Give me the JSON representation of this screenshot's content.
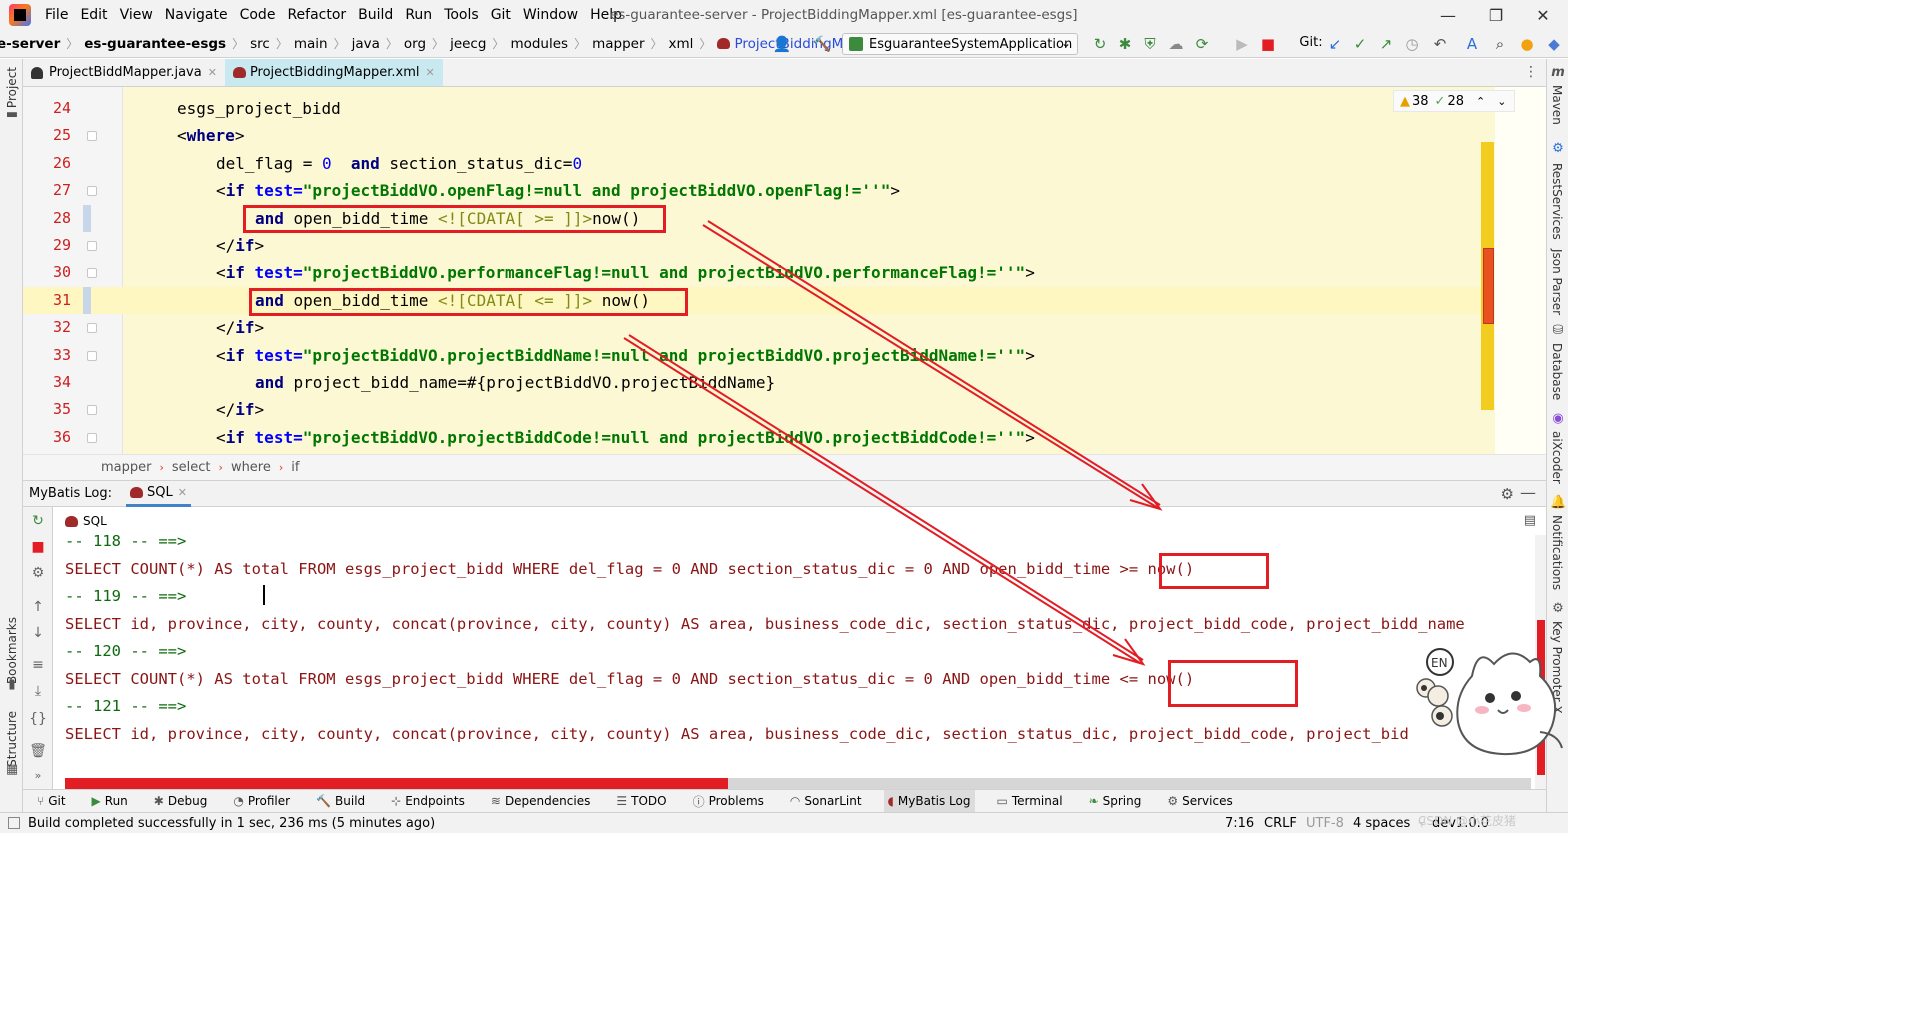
{
  "menubar": {
    "items": [
      "File",
      "Edit",
      "View",
      "Navigate",
      "Code",
      "Refactor",
      "Build",
      "Run",
      "Tools",
      "Git",
      "Window",
      "Help"
    ],
    "window_title": "es-guarantee-server - ProjectBiddingMapper.xml [es-guarantee-esgs]"
  },
  "navbar": {
    "crumbs": [
      "e-server",
      "es-guarantee-esgs",
      "src",
      "main",
      "java",
      "org",
      "jeecg",
      "modules",
      "mapper",
      "xml"
    ],
    "file": "ProjectBiddingMapper.xml",
    "run_config": "EsguaranteeSystemApplication",
    "git_label": "Git:"
  },
  "editor_tabs": [
    {
      "label": "ProjectBiddMapper.java",
      "active": false
    },
    {
      "label": "ProjectBiddingMapper.xml",
      "active": true
    }
  ],
  "inspections": {
    "warnings": "38",
    "weak": "28"
  },
  "code_lines": [
    {
      "num": "24",
      "indent": 0,
      "parts": [
        {
          "t": "esgs_project_bidd",
          "c": ""
        }
      ]
    },
    {
      "num": "25",
      "indent": 0,
      "parts": [
        {
          "t": "<",
          "c": "bracket"
        },
        {
          "t": "where",
          "c": "tag"
        },
        {
          "t": ">",
          "c": "bracket"
        }
      ]
    },
    {
      "num": "26",
      "indent": 1,
      "parts": [
        {
          "t": "del_flag = ",
          "c": ""
        },
        {
          "t": "0",
          "c": "num"
        },
        {
          "t": "  ",
          "c": ""
        },
        {
          "t": "and",
          "c": "kw"
        },
        {
          "t": " section_status_dic=",
          "c": ""
        },
        {
          "t": "0",
          "c": "num"
        }
      ]
    },
    {
      "num": "27",
      "indent": 1,
      "parts": [
        {
          "t": "<",
          "c": "bracket"
        },
        {
          "t": "if ",
          "c": "tag"
        },
        {
          "t": "test=",
          "c": "attr"
        },
        {
          "t": "\"projectBiddVO.openFlag!=null and projectBiddVO.openFlag!=''\"",
          "c": "str"
        },
        {
          "t": ">",
          "c": "bracket"
        }
      ]
    },
    {
      "num": "28",
      "indent": 2,
      "parts": [
        {
          "t": "and",
          "c": "kw"
        },
        {
          "t": " open_bidd_time ",
          "c": ""
        },
        {
          "t": "<![CDATA[ >= ]]>",
          "c": "cdata"
        },
        {
          "t": "now()",
          "c": ""
        }
      ]
    },
    {
      "num": "29",
      "indent": 1,
      "parts": [
        {
          "t": "</",
          "c": "bracket"
        },
        {
          "t": "if",
          "c": "tag"
        },
        {
          "t": ">",
          "c": "bracket"
        }
      ]
    },
    {
      "num": "30",
      "indent": 1,
      "parts": [
        {
          "t": "<",
          "c": "bracket"
        },
        {
          "t": "if ",
          "c": "tag"
        },
        {
          "t": "test=",
          "c": "attr"
        },
        {
          "t": "\"projectBiddVO.performanceFlag!=null and projectBiddVO.performanceFlag!=''\"",
          "c": "str"
        },
        {
          "t": ">",
          "c": "bracket"
        }
      ]
    },
    {
      "num": "31",
      "indent": 2,
      "parts": [
        {
          "t": "and",
          "c": "kw"
        },
        {
          "t": " open_bidd_time ",
          "c": ""
        },
        {
          "t": "<![CDATA[ <= ]]>",
          "c": "cdata"
        },
        {
          "t": " now()",
          "c": ""
        }
      ]
    },
    {
      "num": "32",
      "indent": 1,
      "parts": [
        {
          "t": "</",
          "c": "bracket"
        },
        {
          "t": "if",
          "c": "tag"
        },
        {
          "t": ">",
          "c": "bracket"
        }
      ]
    },
    {
      "num": "33",
      "indent": 1,
      "parts": [
        {
          "t": "<",
          "c": "bracket"
        },
        {
          "t": "if ",
          "c": "tag"
        },
        {
          "t": "test=",
          "c": "attr"
        },
        {
          "t": "\"projectBiddVO.projectBiddName!=null and projectBiddVO.projectBiddName!=''\"",
          "c": "str"
        },
        {
          "t": ">",
          "c": "bracket"
        }
      ]
    },
    {
      "num": "34",
      "indent": 2,
      "parts": [
        {
          "t": "and",
          "c": "kw"
        },
        {
          "t": " project_bidd_name=#{projectBiddVO.projectBiddName}",
          "c": ""
        }
      ]
    },
    {
      "num": "35",
      "indent": 1,
      "parts": [
        {
          "t": "</",
          "c": "bracket"
        },
        {
          "t": "if",
          "c": "tag"
        },
        {
          "t": ">",
          "c": "bracket"
        }
      ]
    },
    {
      "num": "36",
      "indent": 1,
      "parts": [
        {
          "t": "<",
          "c": "bracket"
        },
        {
          "t": "if ",
          "c": "tag"
        },
        {
          "t": "test=",
          "c": "attr"
        },
        {
          "t": "\"projectBiddVO.projectBiddCode!=null and projectBiddVO.projectBiddCode!=''\"",
          "c": "str"
        },
        {
          "t": ">",
          "c": "bracket"
        }
      ]
    }
  ],
  "editor_breadcrumb": [
    "mapper",
    "select",
    "where",
    "if"
  ],
  "tool_window": {
    "title": "MyBatis Log:",
    "tab": "SQL",
    "console_tab": "SQL"
  },
  "log_lines": [
    {
      "kind": "sep",
      "text": "-- 118 -- ==>"
    },
    {
      "kind": "sql",
      "text": "SELECT COUNT(*) AS total FROM esgs_project_bidd WHERE del_flag = 0 AND section_status_dic = 0 AND open_bidd_time >= now()"
    },
    {
      "kind": "sep",
      "text": "-- 119 -- ==>"
    },
    {
      "kind": "sql",
      "text": "SELECT id, province, city, county, concat(province, city, county) AS area, business_code_dic, section_status_dic, project_bidd_code, project_bidd_name"
    },
    {
      "kind": "sep",
      "text": "-- 120 -- ==>"
    },
    {
      "kind": "sql",
      "text": "SELECT COUNT(*) AS total FROM esgs_project_bidd WHERE del_flag = 0 AND section_status_dic = 0 AND open_bidd_time <= now()"
    },
    {
      "kind": "sep",
      "text": "-- 121 -- ==>"
    },
    {
      "kind": "sql",
      "text": "SELECT id, province, city, county, concat(province, city, county) AS area, business_code_dic, section_status_dic, project_bidd_code, project_bid"
    }
  ],
  "bottom_tools": [
    {
      "label": "Git",
      "icon": "git-icon"
    },
    {
      "label": "Run",
      "icon": "run-icon"
    },
    {
      "label": "Debug",
      "icon": "debug-icon"
    },
    {
      "label": "Profiler",
      "icon": "profiler-icon"
    },
    {
      "label": "Build",
      "icon": "build-icon"
    },
    {
      "label": "Endpoints",
      "icon": "endpoints-icon"
    },
    {
      "label": "Dependencies",
      "icon": "dependencies-icon"
    },
    {
      "label": "TODO",
      "icon": "todo-icon"
    },
    {
      "label": "Problems",
      "icon": "problems-icon"
    },
    {
      "label": "SonarLint",
      "icon": "sonarlint-icon"
    },
    {
      "label": "MyBatis Log",
      "icon": "mybatis-icon"
    },
    {
      "label": "Terminal",
      "icon": "terminal-icon"
    },
    {
      "label": "Spring",
      "icon": "spring-icon"
    },
    {
      "label": "Services",
      "icon": "services-icon"
    }
  ],
  "left_stripe": {
    "project": "Project",
    "bookmarks": "Bookmarks",
    "structure": "Structure"
  },
  "right_stripe": [
    "Maven",
    "RestServices",
    "Json Parser",
    "Database",
    "aiXcoder",
    "Notifications",
    "Key Promoter X"
  ],
  "status": {
    "message": "Build completed successfully in 1 sec, 236 ms (5 minutes ago)",
    "position": "7:16",
    "line_sep": "CRLF",
    "encoding": "UTF-8",
    "indent": "4 spaces",
    "branch": "dev1.0.0",
    "watermark": "CSDN @小花皮猪"
  },
  "colors": {
    "annotation_red": "#e21d24",
    "line_number_red": "#cc1f1f",
    "editor_bg": "#fdf8d4"
  }
}
